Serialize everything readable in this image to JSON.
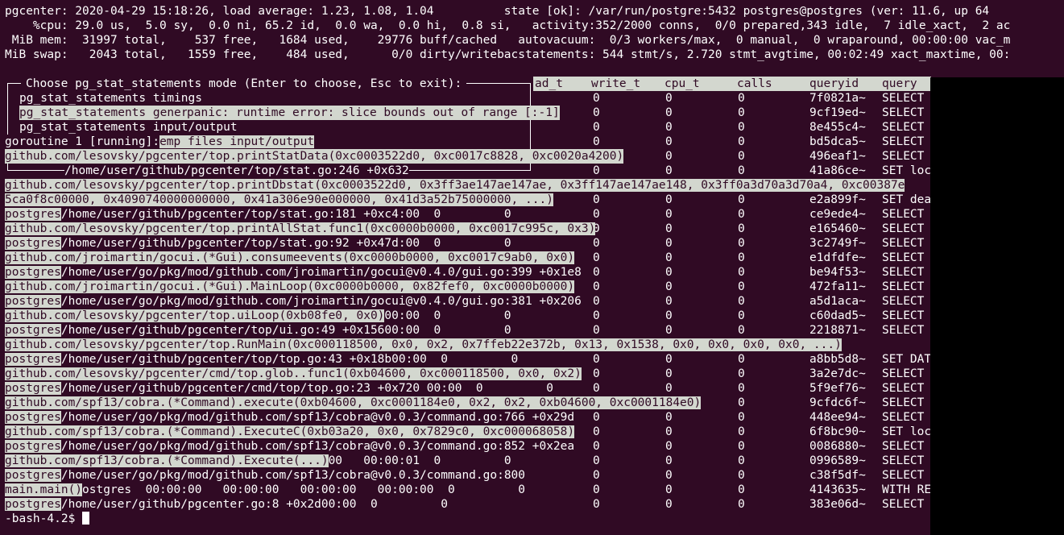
{
  "header": [
    "pgcenter: 2020-04-29 15:18:26, load average: 1.23, 1.08, 1.04          state [ok]: /var/run/postgre:5432 postgres@postgres (ver: 11.6, up 64",
    "    %cpu: 29.0 us,  5.0 sy,  0.0 ni, 65.2 id,  0.0 wa,  0.0 hi,  0.8 si,   activity:352/2000 conns,  0/0 prepared,343 idle,  7 idle_xact,  2 ac",
    " MiB mem:  31997 total,    537 free,   1684 used,    29776 buff/cached   autovacuum:  0/3 workers/max,  0 manual,  0 wraparound, 00:00:00 vac_m",
    "MiB swap:   2043 total,   1559 free,    484 used,      0/0 dirty/writebacstatements: 544 stmt/s, 2.720 stmt_avgtime, 00:02:49 xact_maxtime, 00:"
  ],
  "menu": {
    "title": "Choose pg_stat_statements mode (Enter to choose, Esc to exit):",
    "items": [
      "pg_stat_statements timings",
      "pg_stat_statements general",
      "pg_stat_statements input/output",
      "pg_stat_statements temp files input/output"
    ]
  },
  "columns": [
    "ad_t",
    "write_t",
    "cpu_t",
    "calls",
    "queryid",
    "query"
  ],
  "rows": [
    {
      "c": [
        "0",
        "0",
        "0"
      ],
      "id": "7f0821a~",
      "q": "SELECT"
    },
    {
      "c": [
        "0",
        "0",
        "0"
      ],
      "id": "9cf19ed~",
      "q": "SELECT"
    },
    {
      "c": [
        "0",
        "0",
        "0"
      ],
      "id": "8e455c4~",
      "q": "SELECT"
    },
    {
      "c": [
        "0",
        "0",
        "0"
      ],
      "id": "bd5dca5~",
      "q": "SELECT"
    },
    {
      "c": [
        "0",
        "0",
        "0"
      ],
      "id": "496eaf1~",
      "q": "SELECT"
    },
    {
      "c": [
        "0",
        "0",
        "0"
      ],
      "id": "41a86ce~",
      "q": "SET loc"
    },
    {
      "c": [
        "0",
        "0",
        "0"
      ],
      "id": "",
      "q": ""
    },
    {
      "c": [
        "0",
        "0",
        "0"
      ],
      "id": "e2a899f~",
      "q": "SET dea"
    },
    {
      "c": [
        "0",
        "0",
        "0"
      ],
      "id": "ce9ede4~",
      "q": "SELECT"
    },
    {
      "c": [
        "0",
        "0",
        "0"
      ],
      "id": "e165460~",
      "q": "SELECT"
    },
    {
      "c": [
        "0",
        "0",
        "0"
      ],
      "id": "3c2749f~",
      "q": "SELECT"
    },
    {
      "c": [
        "0",
        "0",
        "0"
      ],
      "id": "e1dfdfe~",
      "q": "SELECT"
    },
    {
      "c": [
        "0",
        "0",
        "0"
      ],
      "id": "be94f53~",
      "q": "SELECT"
    },
    {
      "c": [
        "0",
        "0",
        "0"
      ],
      "id": "472fa11~",
      "q": "SELECT"
    },
    {
      "c": [
        "0",
        "0",
        "0"
      ],
      "id": "a5d1aca~",
      "q": "SELECT"
    },
    {
      "c": [
        "0",
        "0",
        "0"
      ],
      "id": "c60dad5~",
      "q": "SELECT"
    },
    {
      "c": [
        "0",
        "0",
        "0"
      ],
      "id": "2218871~",
      "q": "SELECT"
    },
    {
      "c": [
        "",
        "",
        ""
      ],
      "id": "",
      "q": ""
    },
    {
      "c": [
        "0",
        "0",
        "0"
      ],
      "id": "a8bb5d8~",
      "q": "SET DAT"
    },
    {
      "c": [
        "0",
        "0",
        "0"
      ],
      "id": "3a2e7dc~",
      "q": "SELECT"
    },
    {
      "c": [
        "0",
        "0",
        "0"
      ],
      "id": "5f9ef76~",
      "q": "SELECT"
    },
    {
      "c": [
        "0",
        "0",
        "0"
      ],
      "id": "9cfdc6f~",
      "q": "SELECT"
    },
    {
      "c": [
        "0",
        "0",
        "0"
      ],
      "id": "448ee94~",
      "q": "SELECT"
    },
    {
      "c": [
        "0",
        "0",
        "0"
      ],
      "id": "6f8bc90~",
      "q": "SET loc"
    },
    {
      "c": [
        "0",
        "0",
        "0"
      ],
      "id": "0086880~",
      "q": "SELECT"
    },
    {
      "c": [
        "0",
        "0",
        "0"
      ],
      "id": "0996589~",
      "q": "SELECT"
    },
    {
      "c": [
        "0",
        "0",
        "0"
      ],
      "id": "c38f5df~",
      "q": "SELECT"
    },
    {
      "c": [
        "0",
        "0",
        "0"
      ],
      "id": "4143635~",
      "q": "WITH RE"
    },
    {
      "c": [
        "0",
        "0",
        "0"
      ],
      "id": "383e06d~",
      "q": "SELECT"
    }
  ],
  "panic": [
    {
      "hl": "",
      "plain": ""
    },
    {
      "hl": "",
      "plain": ""
    },
    {
      "hl": "",
      "plain": ""
    },
    {
      "hl": "",
      "plain": ""
    },
    {
      "hl": "",
      "plain": ""
    },
    {
      "hl": "",
      "plain": ""
    },
    {
      "hl": "github.com/lesovsky/pgcenter/top.printDbstat(0xc0003522d0, 0x3ff3ae147ae147ae, 0x3ff147ae147ae148, 0x3ff0a3d70a3d70a4, 0xc00387e",
      "plain": ""
    },
    {
      "hl": "5ca0f8c00000, 0x4090740000000000, 0x41a306e90e000000, 0x41d3a52b75000000, ...)",
      "plain": ""
    },
    {
      "hl": "postgres",
      "plain": "/home/user/github/pgcenter/top/stat.go:181 +0xc4",
      "tail": ":00  0         0"
    },
    {
      "hl": "github.com/lesovsky/pgcenter/top.printAllStat.func1(0xc0000b0000, 0xc0017c995c, 0x3)",
      "plain": ""
    },
    {
      "hl": "postgres",
      "plain": "/home/user/github/pgcenter/top/stat.go:92 +0x47d",
      "tail": ":00  0         0"
    },
    {
      "hl": "github.com/jroimartin/gocui.(*Gui).consumeevents(0xc0000b0000, 0xc0017c9ab0, 0x0)",
      "plain": ""
    },
    {
      "hl": "postgres",
      "plain": "/home/user/go/pkg/mod/github.com/jroimartin/gocui@v0.4.0/gui.go:399 +0x1e8",
      "tail": ""
    },
    {
      "hl": "github.com/jroimartin/gocui.(*Gui).MainLoop(0xc0000b0000, 0x82fef0, 0xc0000b0000)",
      "plain": ""
    },
    {
      "hl": "postgres",
      "plain": "/home/user/go/pkg/mod/github.com/jroimartin/gocui@v0.4.0/gui.go:381 +0x206",
      "tail": ""
    },
    {
      "hl": "github.com/lesovsky/pgcenter/top.uiLoop(0xb08fe0, 0x0)",
      "plain": "",
      "tail": "00:00  0         0"
    },
    {
      "hl": "postgres",
      "plain": "/home/user/github/pgcenter/top/ui.go:49 +0x156",
      "tail": "00:00  0         0"
    },
    {
      "hl": "github.com/lesovsky/pgcenter/top.RunMain(0xc000118500, 0x0, 0x2, 0x7ffeb22e372b, 0x13, 0x1538, 0x0, 0x0, 0x0, 0x0, ...)",
      "plain": ""
    },
    {
      "hl": "postgres",
      "plain": "/home/user/github/pgcenter/top/top.go:43 +0x18b",
      "tail": "00:00  0         0"
    },
    {
      "hl": "github.com/lesovsky/pgcenter/cmd/top.glob..func1(0xb04600, 0xc000118500, 0x0, 0x2)",
      "plain": ""
    },
    {
      "hl": "postgres",
      "plain": "/home/user/github/pgcenter/cmd/top/top.go:23 +0x72",
      "tail": "0 00:00  0         0"
    },
    {
      "hl": "github.com/spf13/cobra.(*Command).execute(0xb04600, 0xc0001184e0, 0x2, 0x2, 0xb04600, 0xc0001184e0)",
      "plain": ""
    },
    {
      "hl": "postgres",
      "plain": "/home/user/go/pkg/mod/github.com/spf13/cobra@v0.0.3/command.go:766 +0x29d",
      "tail": ""
    },
    {
      "hl": "github.com/spf13/cobra.(*Command).ExecuteC(0xb03a20, 0x0, 0x7829c0, 0xc000068058)",
      "plain": ""
    },
    {
      "hl": "postgres",
      "plain": "/home/user/go/pkg/mod/github.com/spf13/cobra@v0.0.3/command.go:852 +0x2ea",
      "tail": ""
    },
    {
      "hl": "github.com/spf13/cobra.(*Command).Execute(...)",
      "plain": "",
      "tail": "00   00:00:01  0         0"
    },
    {
      "hl": "postgres",
      "plain": "/home/user/go/pkg/mod/github.com/spf13/cobra@v0.0.3/command.go:800",
      "tail": ""
    },
    {
      "hl": "main.main()",
      "plain": "",
      "tail": "ostgres  00:00:00   00:00:00   00:00:00   00:00:00  0         0"
    },
    {
      "hl": "postgres",
      "plain": "/home/user/github/pgcenter.go:8 +0x2d",
      "tail": "00:00  0         0"
    }
  ],
  "overlays": {
    "panic_line": "panic: runtime error: slice bounds out of range [:-1]",
    "goroutine": "goroutine 1 [running]:",
    "goroutine_tail": "emp files input/output",
    "printstat": "github.com/lesovsky/pgcenter/top.printStatData(0xc0003522d0, 0xc0017c8828, 0xc0020a4200)",
    "stat246": "/home/user/github/pgcenter/top/stat.go:246 +0x632"
  },
  "prompt": "-bash-4.2$ "
}
